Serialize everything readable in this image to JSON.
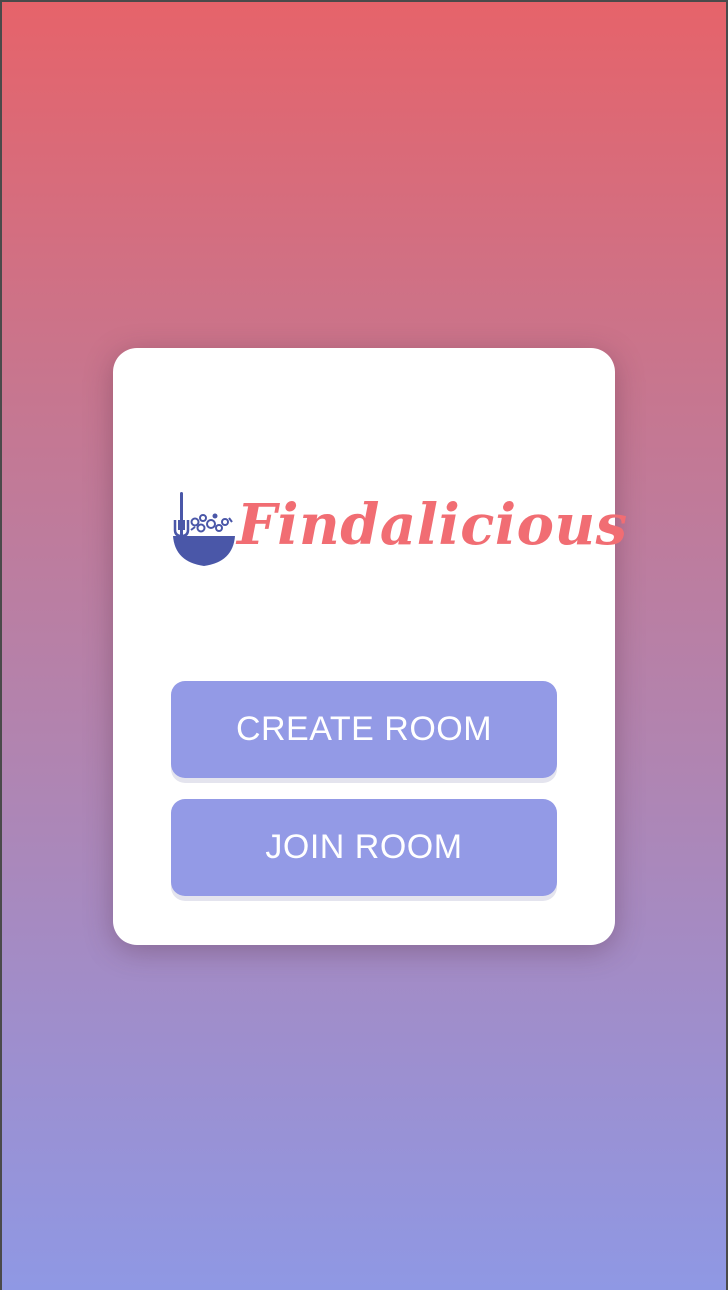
{
  "app": {
    "logo_text": "Findalicious"
  },
  "actions": {
    "create_label": "CREATE ROOM",
    "join_label": "JOIN ROOM"
  },
  "colors": {
    "background_top": "#e6636a",
    "background_bottom": "#8f98e4",
    "card": "#ffffff",
    "button": "#939ae6",
    "button_text": "#ffffff",
    "logo_text": "#f16d73",
    "logo_icon": "#4a57a8"
  },
  "icons": {
    "logo": "bowl-with-fork-icon"
  }
}
